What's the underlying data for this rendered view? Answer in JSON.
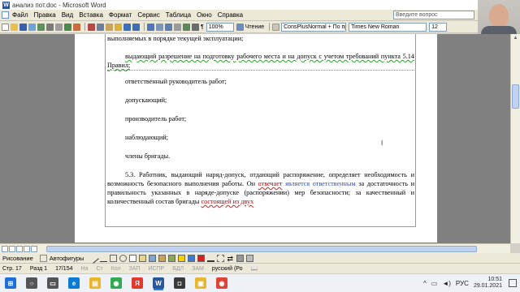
{
  "window": {
    "title": "анализ пот.doc - Microsoft Word"
  },
  "menu": {
    "items": [
      "Файл",
      "Правка",
      "Вид",
      "Вставка",
      "Формат",
      "Сервис",
      "Таблица",
      "Окно",
      "Справка"
    ],
    "help_placeholder": "Введите вопрос"
  },
  "toolbar": {
    "zoom": "100%",
    "reading_label": "Чтение",
    "style": "ConsPlusNormal + По праве",
    "font": "Times New Roman",
    "size": "12"
  },
  "document": {
    "lines": {
      "l1": "выполняемых в порядке текущей эксплуатации;",
      "l2": "выдающий разрешение на подготовку рабочего места и на допуск с учетом требований пункта 5.14 Правил;",
      "l3": "ответственный руководитель работ;",
      "l4": "допускающий;",
      "l5": "производитель работ;",
      "l6": "наблюдающий;",
      "l7": "члены бригады.",
      "p53_a": "5.3. Работник, выдающий наряд-допуск, отдающий распоряжение, определяет необходимость и возможность безопасного выполнения работы. Он ",
      "p53_red1": "отвечает",
      "p53_b": " ",
      "p53_blue": "является ответственным",
      "p53_c": " за достаточность и правильность указанных в наряде-допуске (распоряжении) мер безопасности; за качественный и количественный состав бригады ",
      "p53_red2": "состоящей из двух"
    }
  },
  "drawing_bar": {
    "drawing_label": "Рисование",
    "autoshapes_label": "Автофигуры"
  },
  "status": {
    "page": "Стр. 17",
    "section": "Разд 1",
    "pages": "17/154",
    "at": "На",
    "line": "Ст",
    "col": "Кол",
    "rec": "ЗАП",
    "trk": "ИСПР",
    "ext": "ВДЛ",
    "ovr": "ЗАМ",
    "lang": "русский (Ро"
  },
  "taskbar": {
    "lang": "РУС",
    "time": "10:51",
    "date": "29.01.2021",
    "apps": [
      {
        "name": "start",
        "color": "#1e6fd9"
      },
      {
        "name": "search",
        "color": "#555555"
      },
      {
        "name": "task-view",
        "color": "#555555"
      },
      {
        "name": "edge",
        "color": "#0c7bd4"
      },
      {
        "name": "explorer",
        "color": "#e8b62f"
      },
      {
        "name": "chrome",
        "color": "#34a853"
      },
      {
        "name": "yandex",
        "color": "#e03a2f"
      },
      {
        "name": "word",
        "color": "#2b5797"
      },
      {
        "name": "camera",
        "color": "#3a3a3a"
      },
      {
        "name": "folder",
        "color": "#e8b62f"
      },
      {
        "name": "chrome-alt",
        "color": "#db4437"
      }
    ]
  }
}
